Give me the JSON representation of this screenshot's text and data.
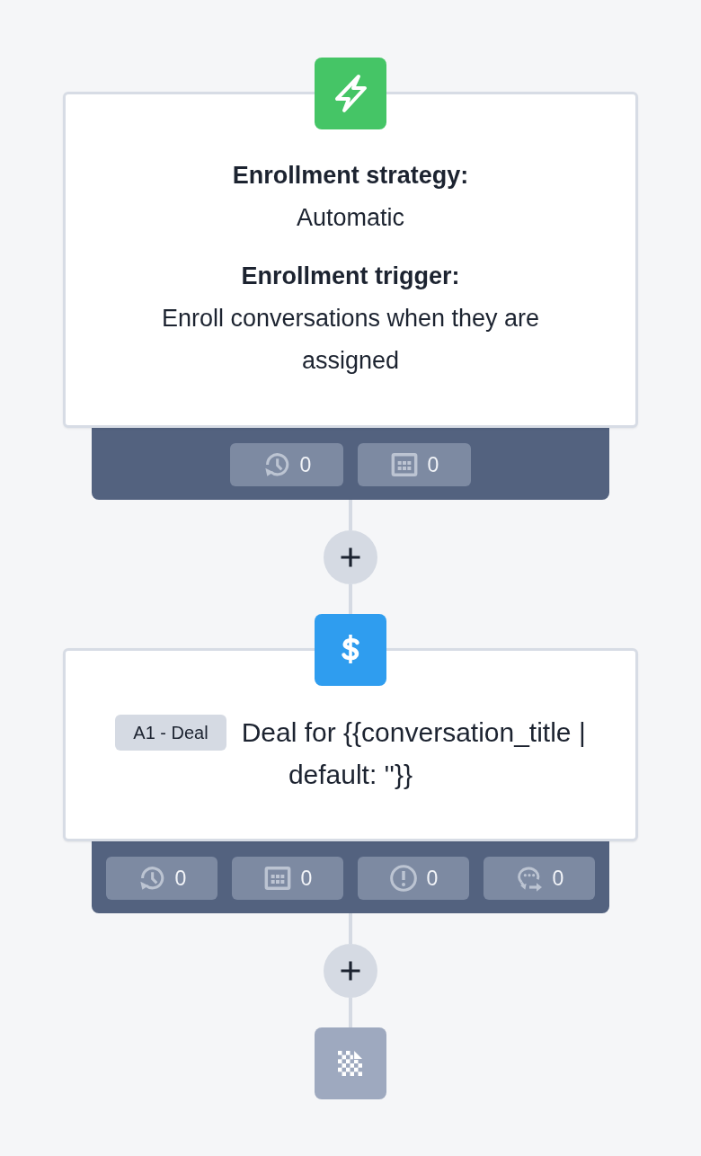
{
  "nodes": [
    {
      "kind": "trigger",
      "fields": [
        {
          "label": "Enrollment strategy:",
          "value": "Automatic"
        },
        {
          "label": "Enrollment trigger:",
          "value": "Enroll conversations when they are assigned"
        }
      ],
      "stats": [
        {
          "kind": "history",
          "count": "0"
        },
        {
          "kind": "calendar",
          "count": "0"
        }
      ]
    },
    {
      "kind": "action",
      "tag": "A1 - Deal",
      "text": "Deal for {{conversation_title | default: ''}}",
      "stats": [
        {
          "kind": "history",
          "count": "0"
        },
        {
          "kind": "calendar",
          "count": "0"
        },
        {
          "kind": "error",
          "count": "0"
        },
        {
          "kind": "chat",
          "count": "0"
        }
      ]
    },
    {
      "kind": "end"
    }
  ]
}
